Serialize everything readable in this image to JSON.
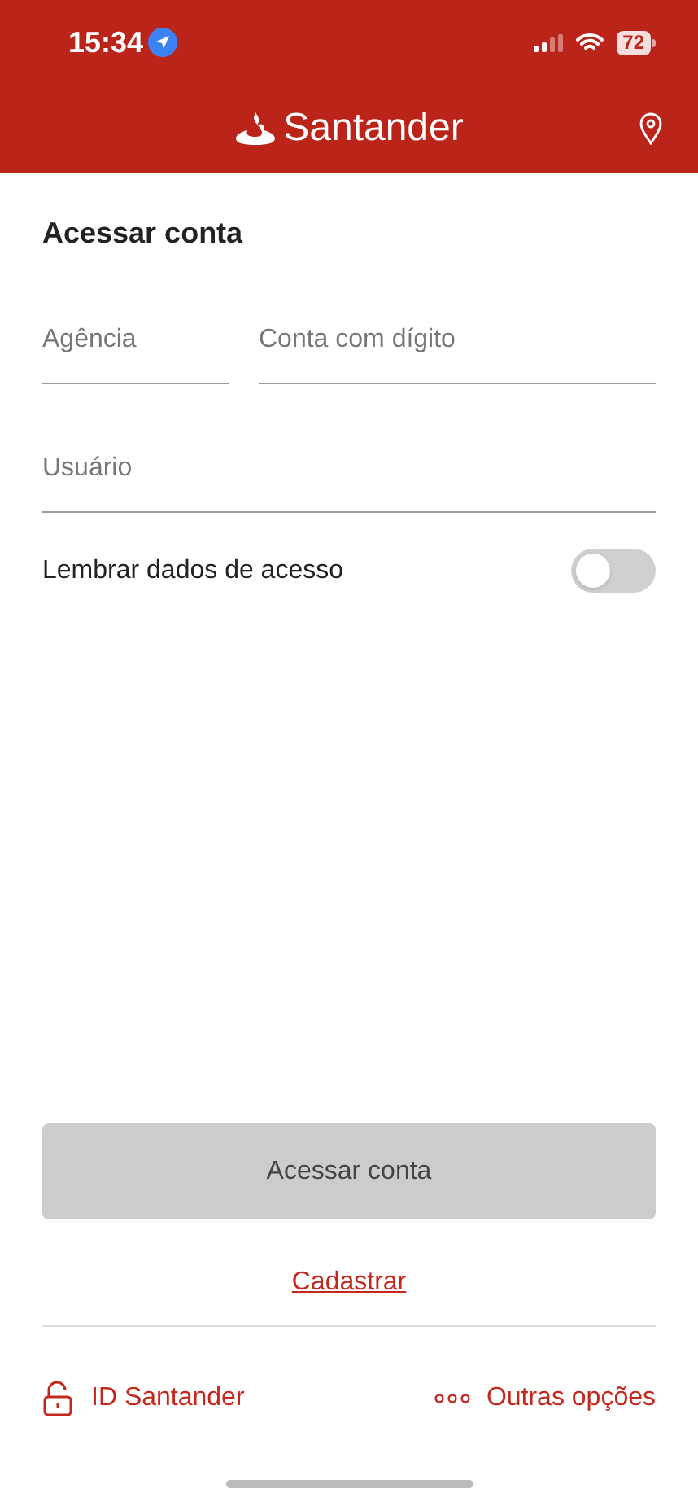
{
  "status_bar": {
    "time": "15:34",
    "battery": "72"
  },
  "header": {
    "logo_text": "Santander"
  },
  "title": "Acessar conta",
  "fields": [
    {
      "placeholder": "Agência"
    },
    {
      "placeholder": "Conta com dígito"
    },
    {
      "placeholder": "Usuário"
    }
  ],
  "remember": {
    "label": "Lembrar dados de acesso",
    "on": false
  },
  "submit": {
    "label": "Acessar conta",
    "disabled": true
  },
  "register_link": "Cadastrar",
  "footer": [
    {
      "kind": "lock",
      "label": "ID Santander"
    },
    {
      "kind": "dots",
      "label": "Outras opções"
    }
  ]
}
